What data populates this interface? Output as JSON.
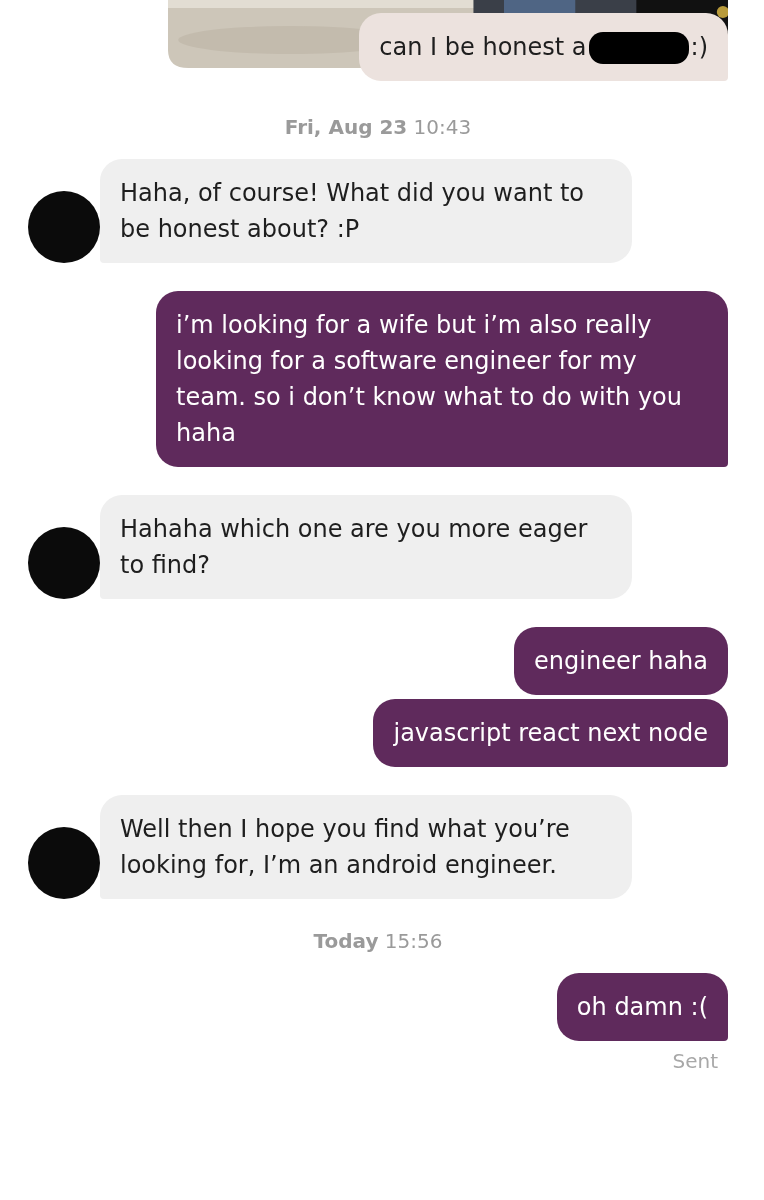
{
  "messages": [
    {
      "kind": "photo_reply",
      "text": "can I be honest a",
      "redacted": true,
      "text_after": ":)",
      "tail": true
    },
    {
      "kind": "timestamp",
      "date": "Fri, Aug 23",
      "time": "10:43"
    },
    {
      "kind": "incoming",
      "text": "Haha, of course! What did you want to be honest about? :P",
      "avatar": true
    },
    {
      "kind": "outgoing",
      "text": "i’m looking for a wife but i’m also really looking for a software engineer for my team. so i don’t know what to do with you haha",
      "tail": true
    },
    {
      "kind": "incoming",
      "text": "Hahaha which one are you more eager to find?",
      "avatar": true
    },
    {
      "kind": "outgoing",
      "text": "engineer haha",
      "tail": false
    },
    {
      "kind": "outgoing",
      "text": "javascript react next node",
      "tail": true
    },
    {
      "kind": "incoming",
      "text": "Well then I hope you find what you’re looking for, I’m an android engineer.",
      "avatar": true
    },
    {
      "kind": "timestamp",
      "date": "Today",
      "time": "15:56"
    },
    {
      "kind": "outgoing",
      "text": "oh damn :(",
      "tail": true
    },
    {
      "kind": "status",
      "text": "Sent"
    }
  ]
}
